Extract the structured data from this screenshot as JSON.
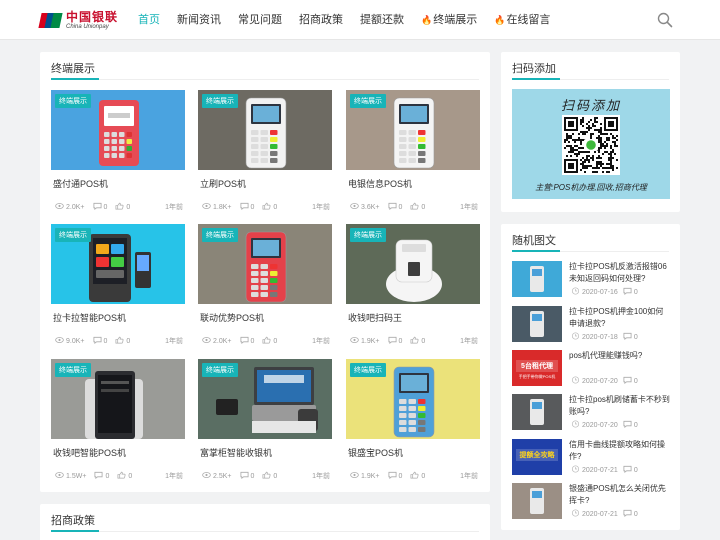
{
  "brand": {
    "cn": "中国银联",
    "en": "China Unionpay"
  },
  "nav": [
    {
      "label": "首页",
      "hot": false,
      "active": true
    },
    {
      "label": "新闻资讯",
      "hot": false
    },
    {
      "label": "常见问题",
      "hot": false
    },
    {
      "label": "招商政策",
      "hot": false
    },
    {
      "label": "提额还款",
      "hot": false
    },
    {
      "label": "终端展示",
      "hot": true
    },
    {
      "label": "在线留言",
      "hot": true
    }
  ],
  "sections": {
    "terminals": "终端展示",
    "scan": "扫码添加",
    "random": "随机图文",
    "policy": "招商政策"
  },
  "badge": "终端展示",
  "products": [
    {
      "name": "盛付通POS机",
      "views": "2.0K+",
      "comments": "0",
      "likes": "0",
      "time": "1年前",
      "device": "mini",
      "bg": "#4aa3e0",
      "body": "#e64b55"
    },
    {
      "name": "立刷POS机",
      "views": "1.8K+",
      "comments": "0",
      "likes": "0",
      "time": "1年前",
      "device": "pos",
      "bg": "#6d6a62",
      "body": "#f2f2f2"
    },
    {
      "name": "电银信息POS机",
      "views": "3.6K+",
      "comments": "0",
      "likes": "0",
      "time": "1年前",
      "device": "pos",
      "bg": "#a7988a",
      "body": "#f4f4f4"
    },
    {
      "name": "拉卡拉智能POS机",
      "views": "9.0K+",
      "comments": "0",
      "likes": "0",
      "time": "1年前",
      "device": "smart",
      "bg": "#27c3e8",
      "body": "#3a3a3a"
    },
    {
      "name": "联动优势POS机",
      "views": "2.0K+",
      "comments": "0",
      "likes": "0",
      "time": "1年前",
      "device": "pos",
      "bg": "#8a8578",
      "body": "#e4414a"
    },
    {
      "name": "收钱吧扫码王",
      "views": "1.9K+",
      "comments": "0",
      "likes": "0",
      "time": "1年前",
      "device": "scanner",
      "bg": "#5e6a58",
      "body": "#f5f5f5"
    },
    {
      "name": "收钱吧智能POS机",
      "views": "1.5W+",
      "comments": "0",
      "likes": "0",
      "time": "1年前",
      "device": "tablet",
      "bg": "#9a9b97",
      "body": "#e9e9e9"
    },
    {
      "name": "富掌柜智能收银机",
      "views": "2.5K+",
      "comments": "0",
      "likes": "0",
      "time": "1年前",
      "device": "register",
      "bg": "#5a6e63",
      "body": "#3d3f42"
    },
    {
      "name": "银盛宝POS机",
      "views": "1.9K+",
      "comments": "0",
      "likes": "0",
      "time": "1年前",
      "device": "pos",
      "bg": "#ebe27a",
      "body": "#4fa0d8"
    }
  ],
  "scan": {
    "title": "扫码添加",
    "caption": "主营:POS机办理,回收,招商代理"
  },
  "random_posts": [
    {
      "title": "拉卡拉POS机反激活报错06未知返回码如何处理?",
      "date": "2020-07-16",
      "comments": "0",
      "thumb": "#3fa9d8"
    },
    {
      "title": "拉卡拉POS机押金100如何申请退款?",
      "date": "2020-07-18",
      "comments": "0",
      "thumb": "#4a5a66"
    },
    {
      "title": "pos机代理能赚钱吗?",
      "date": "2020-07-20",
      "comments": "0",
      "thumb": "#d92a2a",
      "thumb_text": "5台租代理",
      "thumb_sub": "手把手带你做POS机"
    },
    {
      "title": "拉卡拉pos机刷储蓄卡不秒到账吗?",
      "date": "2020-07-20",
      "comments": "0",
      "thumb": "#585a5c"
    },
    {
      "title": "信用卡曲线提额攻略如何操作?",
      "date": "2020-07-21",
      "comments": "0",
      "thumb": "#1f3fa8",
      "thumb_text": "提额全攻略"
    },
    {
      "title": "银盛通POS机怎么关闭优先挥卡?",
      "date": "2020-07-21",
      "comments": "0",
      "thumb": "#9b8f85"
    }
  ],
  "colors": {
    "accent": "#18b4b8",
    "hot": "#f0433d"
  }
}
